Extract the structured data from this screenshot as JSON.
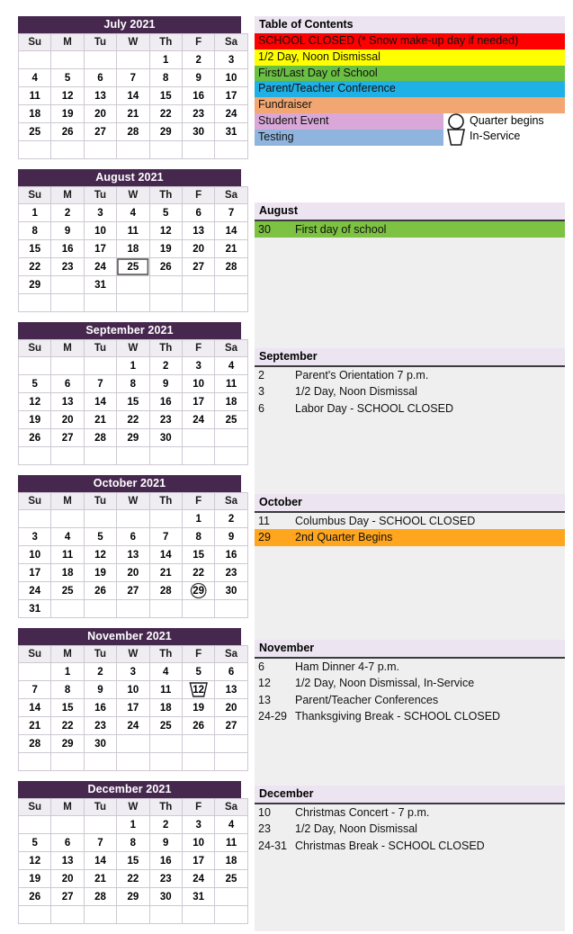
{
  "weekday_headers": [
    "Su",
    "M",
    "Tu",
    "W",
    "Th",
    "F",
    "Sa"
  ],
  "legend": {
    "title": "Table of Contents",
    "items": [
      {
        "label": "SCHOOL CLOSED (* Snow make-up day if needed)",
        "color": "#ff0000",
        "class": "closed",
        "short": false
      },
      {
        "label": "1/2 Day, Noon Dismissal",
        "color": "#ffff00",
        "class": "halfday",
        "short": false
      },
      {
        "label": "First/Last Day of School",
        "color": "#6ac043",
        "class": "firstlast",
        "short": false
      },
      {
        "label": "Parent/Teacher Conference",
        "color": "#1fb1e6",
        "class": "ptconf",
        "short": false
      },
      {
        "label": "Fundraiser",
        "color": "#f2a772",
        "class": "fundraiser",
        "short": false
      },
      {
        "label": "Student Event",
        "color": "#d9a8d9",
        "class": "studentevt",
        "short": true
      },
      {
        "label": "Testing",
        "color": "#8fb5de",
        "class": "testing",
        "short": true
      }
    ],
    "icons": [
      {
        "name": "quarter-begins-icon",
        "label": "Quarter begins",
        "shape": "circle"
      },
      {
        "name": "in-service-icon",
        "label": "In-Service",
        "shape": "trapezoid"
      }
    ]
  },
  "months": [
    {
      "id": "july",
      "title": "July 2021",
      "lead_blanks": 4,
      "days": 31,
      "trailing_blanks": 4,
      "marks": {},
      "events_label": null,
      "events": []
    },
    {
      "id": "august",
      "title": "August 2021",
      "lead_blanks": 0,
      "days": 31,
      "trailing_blanks": 11,
      "marks": {
        "25": {
          "type": "in-service"
        },
        "30": {
          "type": "firstlast"
        }
      },
      "events_label": "August",
      "events": [
        {
          "date": "30",
          "text": "First day of school",
          "highlight": "green"
        }
      ]
    },
    {
      "id": "september",
      "title": "September 2021",
      "lead_blanks": 3,
      "days": 30,
      "trailing_blanks": 9,
      "marks": {
        "2": {
          "type": "ptconf"
        },
        "3": {
          "type": "halfday"
        },
        "6": {
          "type": "closed"
        }
      },
      "events_label": "September",
      "events": [
        {
          "date": "2",
          "text": "Parent's Orientation 7 p.m.",
          "highlight": "none"
        },
        {
          "date": "3",
          "text": "1/2 Day, Noon Dismissal",
          "highlight": "none"
        },
        {
          "date": "6",
          "text": "Labor Day - SCHOOL CLOSED",
          "highlight": "none"
        }
      ]
    },
    {
      "id": "october",
      "title": "October 2021",
      "lead_blanks": 5,
      "days": 31,
      "trailing_blanks": 6,
      "marks": {
        "11": {
          "type": "closed"
        },
        "29": {
          "type": "quarter"
        }
      },
      "events_label": "October",
      "events": [
        {
          "date": "11",
          "text": "Columbus Day - SCHOOL CLOSED",
          "highlight": "none"
        },
        {
          "date": "29",
          "text": "2nd Quarter Begins",
          "highlight": "orange"
        }
      ]
    },
    {
      "id": "november",
      "title": "November 2021",
      "lead_blanks": 1,
      "days": 30,
      "trailing_blanks": 11,
      "marks": {
        "6": {
          "type": "fundraiser"
        },
        "12": {
          "type": "halfday-in-service"
        },
        "13": {
          "type": "ptconf"
        },
        "24": {
          "type": "closed"
        },
        "25": {
          "type": "closed"
        },
        "26": {
          "type": "closed"
        },
        "29": {
          "type": "closed"
        }
      },
      "events_label": "November",
      "events": [
        {
          "date": "6",
          "text": "Ham Dinner 4-7 p.m.",
          "highlight": "none"
        },
        {
          "date": "12",
          "text": "1/2 Day, Noon Dismissal, In-Service",
          "highlight": "none"
        },
        {
          "date": "13",
          "text": "Parent/Teacher Conferences",
          "highlight": "none"
        },
        {
          "date": "24-29",
          "text": "Thanksgiving Break - SCHOOL CLOSED",
          "highlight": "none"
        }
      ]
    },
    {
      "id": "december",
      "title": "December 2021",
      "lead_blanks": 3,
      "days": 31,
      "trailing_blanks": 7,
      "marks": {
        "10": {
          "type": "studentevt"
        },
        "23": {
          "type": "halfday"
        },
        "24": {
          "type": "closed"
        },
        "27": {
          "type": "closed"
        },
        "28": {
          "type": "closed"
        },
        "29": {
          "type": "closed"
        },
        "30": {
          "type": "closed"
        },
        "31": {
          "type": "closed"
        }
      },
      "events_label": "December",
      "events": [
        {
          "date": "10",
          "text": "Christmas Concert - 7 p.m.",
          "highlight": "none"
        },
        {
          "date": "23",
          "text": "1/2 Day, Noon Dismissal",
          "highlight": "none"
        },
        {
          "date": "24-31",
          "text": "Christmas Break - SCHOOL CLOSED",
          "highlight": "none"
        }
      ]
    }
  ]
}
